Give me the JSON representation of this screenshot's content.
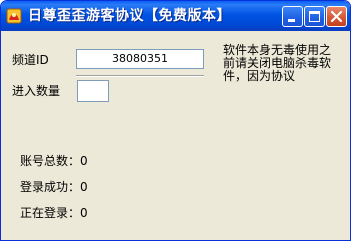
{
  "window": {
    "title": "日尊歪歪游客协议【免费版本】",
    "controls": {
      "minimize": "minimize",
      "maximize": "maximize",
      "close": "close"
    },
    "colors": {
      "titlebar": "#0054e3",
      "body": "#ece9d8",
      "close": "#d45a37"
    }
  },
  "form": {
    "channel_id_label": "频道ID",
    "channel_id_value": "38080351",
    "quantity_label": "进入数量",
    "quantity_value": ""
  },
  "notice": "软件本身无毒使用之前请关闭电脑杀毒软件，因为协议",
  "stats": {
    "total_accounts_label": "账号总数：0",
    "login_success_label": "登录成功：0",
    "logging_in_label": "正在登录：0"
  }
}
